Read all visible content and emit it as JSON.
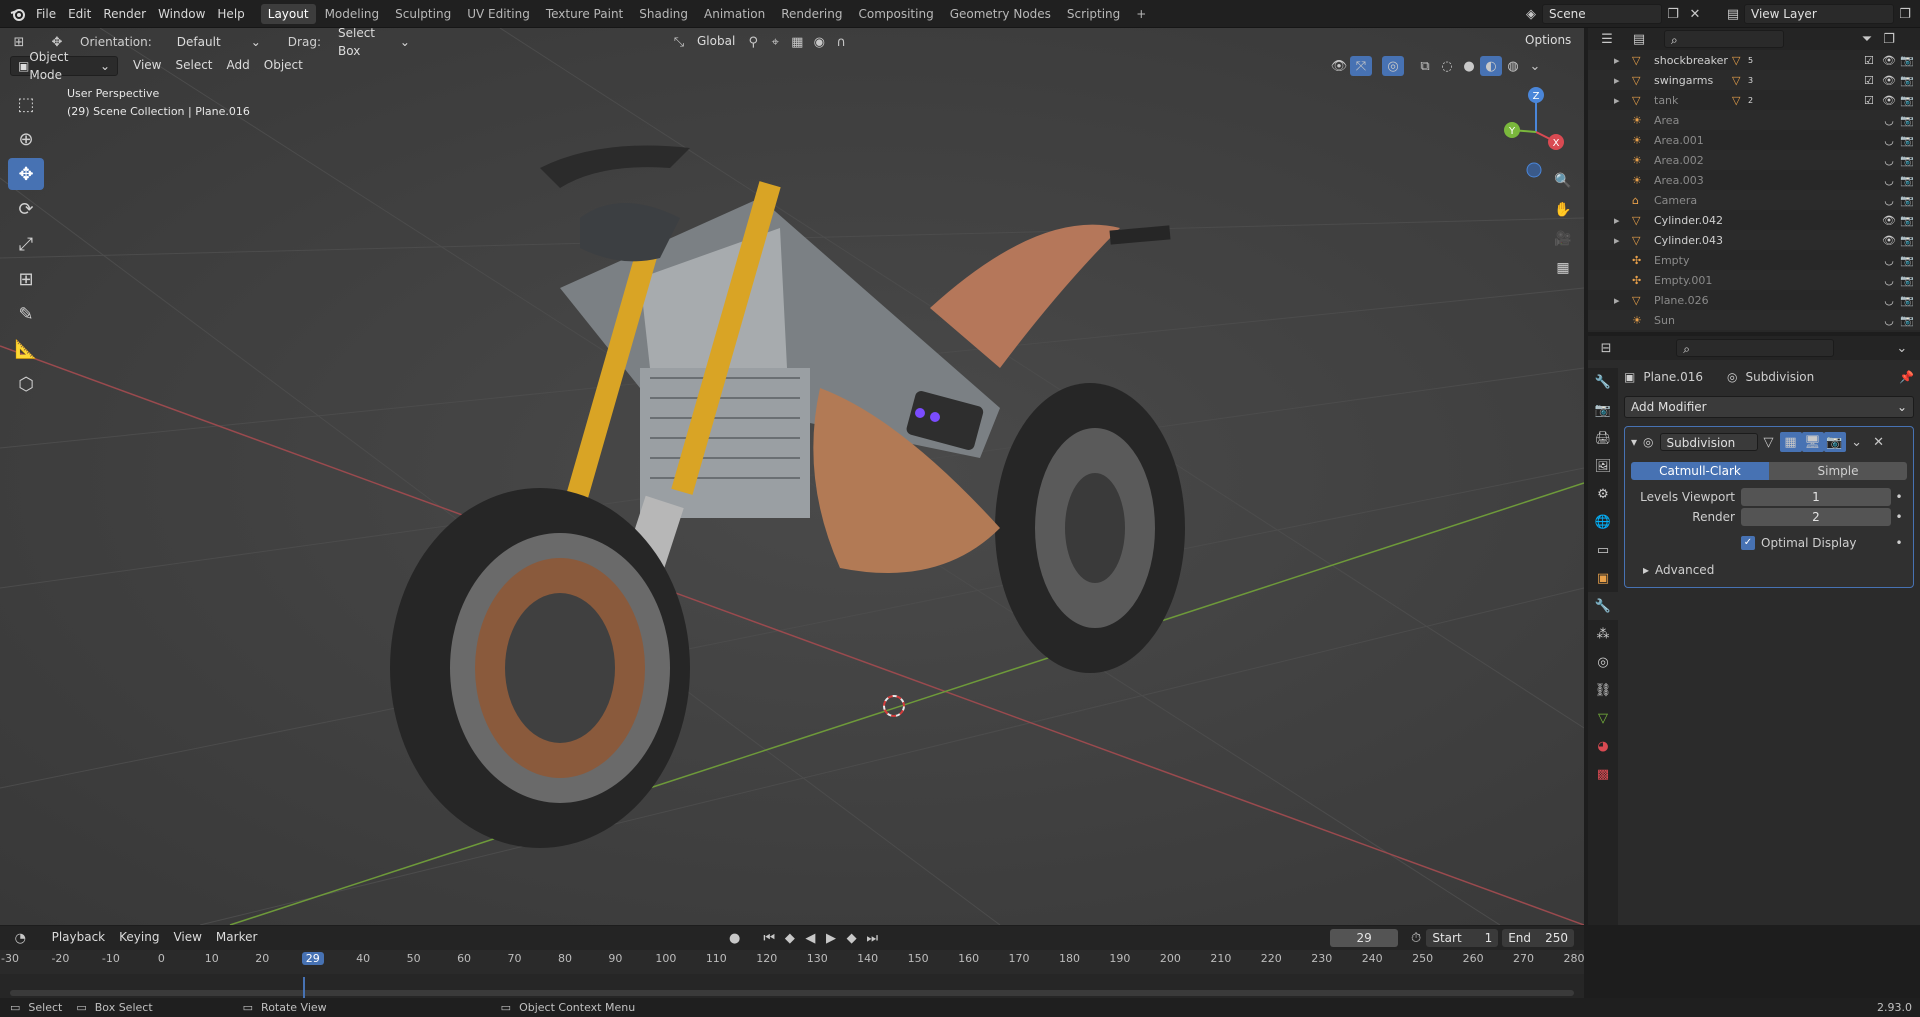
{
  "topbar": {
    "menus": [
      "File",
      "Edit",
      "Render",
      "Window",
      "Help"
    ],
    "workspaces": [
      "Layout",
      "Modeling",
      "Sculpting",
      "UV Editing",
      "Texture Paint",
      "Shading",
      "Animation",
      "Rendering",
      "Compositing",
      "Geometry Nodes",
      "Scripting"
    ],
    "active_workspace": "Layout",
    "add_tab": "+",
    "scene": "Scene",
    "view_layer": "View Layer"
  },
  "viewport_header": {
    "orientation_label": "Orientation:",
    "orientation_value": "Default",
    "drag_label": "Drag:",
    "drag_value": "Select Box",
    "transform_orientation": "Global",
    "options": "Options",
    "mode": "Object Mode",
    "menus": [
      "View",
      "Select",
      "Add",
      "Object"
    ]
  },
  "viewport": {
    "perspective": "User Perspective",
    "collection_info": "(29) Scene Collection | Plane.016",
    "gizmo_axes": [
      "Z",
      "Y",
      "X"
    ]
  },
  "outliner": {
    "items": [
      {
        "name": "shockbreaker",
        "badge": "5",
        "icon": "mesh-icon",
        "dim": false,
        "checkbox": true
      },
      {
        "name": "swingarms",
        "badge": "3",
        "icon": "mesh-icon",
        "dim": false,
        "checkbox": true
      },
      {
        "name": "tank",
        "badge": "2",
        "icon": "mesh-icon",
        "dim": true,
        "checkbox": true
      },
      {
        "name": "Area",
        "badge": "",
        "icon": "light-icon",
        "dim": true,
        "checkbox": false
      },
      {
        "name": "Area.001",
        "badge": "",
        "icon": "light-icon",
        "dim": true,
        "checkbox": false
      },
      {
        "name": "Area.002",
        "badge": "",
        "icon": "light-icon",
        "dim": true,
        "checkbox": false
      },
      {
        "name": "Area.003",
        "badge": "",
        "icon": "light-icon",
        "dim": true,
        "checkbox": false
      },
      {
        "name": "Camera",
        "badge": "",
        "icon": "camera-icon",
        "dim": true,
        "checkbox": false
      },
      {
        "name": "Cylinder.042",
        "badge": "",
        "icon": "mesh-icon",
        "dim": false,
        "checkbox": false
      },
      {
        "name": "Cylinder.043",
        "badge": "",
        "icon": "mesh-icon",
        "dim": false,
        "checkbox": false
      },
      {
        "name": "Empty",
        "badge": "",
        "icon": "empty-icon",
        "dim": true,
        "checkbox": false
      },
      {
        "name": "Empty.001",
        "badge": "",
        "icon": "empty-icon",
        "dim": true,
        "checkbox": false
      },
      {
        "name": "Plane.026",
        "badge": "",
        "icon": "mesh-icon",
        "dim": true,
        "checkbox": false
      },
      {
        "name": "Sun",
        "badge": "",
        "icon": "light-icon",
        "dim": true,
        "checkbox": false
      }
    ]
  },
  "properties": {
    "object_name": "Plane.016",
    "modifier_context": "Subdivision",
    "add_modifier": "Add Modifier",
    "modifier": {
      "name": "Subdivision",
      "type_options": [
        "Catmull-Clark",
        "Simple"
      ],
      "active_type": "Catmull-Clark",
      "levels_viewport_label": "Levels Viewport",
      "levels_viewport": "1",
      "render_label": "Render",
      "render": "2",
      "optimal_display_label": "Optimal Display",
      "optimal_display": true,
      "advanced_label": "Advanced"
    }
  },
  "timeline": {
    "menus": [
      "Playback",
      "Keying",
      "View",
      "Marker"
    ],
    "current_frame": "29",
    "start_label": "Start",
    "start": "1",
    "end_label": "End",
    "end": "250",
    "ticks": [
      "-30",
      "-20",
      "-10",
      "0",
      "10",
      "20",
      "29",
      "40",
      "50",
      "60",
      "70",
      "80",
      "90",
      "100",
      "110",
      "120",
      "130",
      "140",
      "150",
      "160",
      "170",
      "180",
      "190",
      "200",
      "210",
      "220",
      "230",
      "240",
      "250",
      "260",
      "270",
      "280"
    ]
  },
  "statusbar": {
    "select": "Select",
    "box_select": "Box Select",
    "rotate_view": "Rotate View",
    "context_menu": "Object Context Menu",
    "version": "2.93.0"
  },
  "colors": {
    "accent": "#4772b3",
    "mesh_orange": "#e8a04a",
    "axis_x": "#d94a52",
    "axis_y": "#7ab83c",
    "axis_z": "#4a86d9"
  }
}
